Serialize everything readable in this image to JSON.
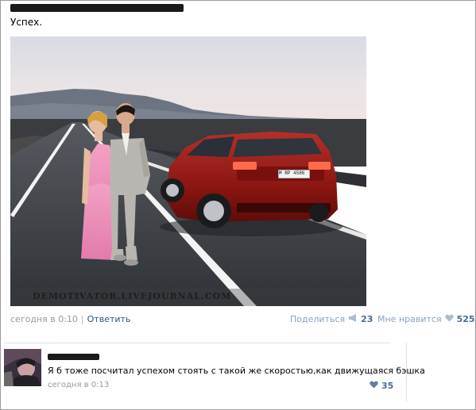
{
  "post": {
    "text": "Успех.",
    "watermark": "DEMOTIVATOR.LIVEJOURNAL.COM",
    "plate": "M RP 4586",
    "time": "сегодня в 0:10",
    "separator": "|",
    "reply_label": "Ответить",
    "share_label": "Поделиться",
    "share_count": "23",
    "like_label": "Мне нравится",
    "like_count": "525"
  },
  "comment": {
    "text": "Я б тоже посчитал успехом стоять с такой же скоростью,как движущаяся бэшка",
    "time": "сегодня в 0:13",
    "like_count": "35"
  },
  "colors": {
    "link": "#2b587a",
    "meta": "#999999",
    "count": "#4a6d8f"
  }
}
